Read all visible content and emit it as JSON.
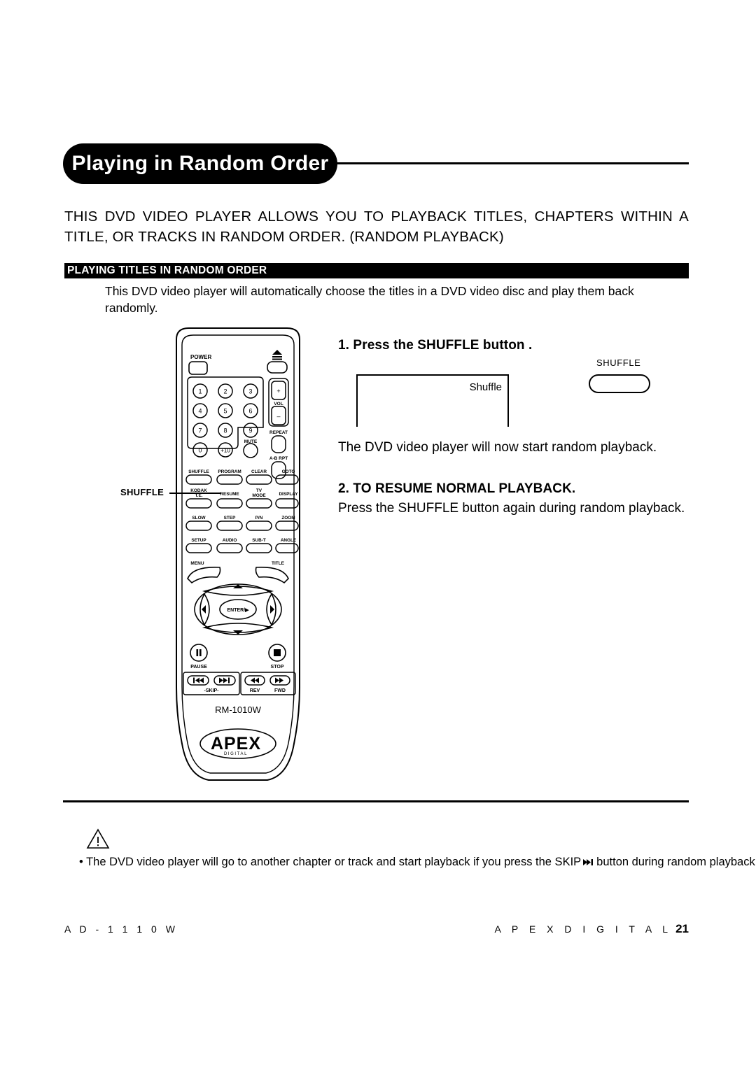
{
  "page": {
    "title": "Playing in Random Order",
    "intro": "THIS DVD VIDEO PLAYER ALLOWS YOU TO PLAYBACK TITLES, CHAPTERS WITHIN A TITLE, OR TRACKS IN RANDOM ORDER.  (RANDOM PLAYBACK)"
  },
  "section": {
    "bar_label": "PLAYING TITLES IN RANDOM ORDER",
    "description": "This DVD video player will automatically choose the titles in a DVD video disc and play them back randomly."
  },
  "steps": {
    "step1_heading": "1. Press the SHUFFLE button .",
    "osd_text": "Shuffle",
    "key_label": "SHUFFLE",
    "step1_result": "The DVD video player will now start random playback.",
    "step2_heading": "2. TO RESUME NORMAL PLAYBACK.",
    "step2_body": "Press the SHUFFLE button again during random playback."
  },
  "callout": {
    "label": "SHUFFLE"
  },
  "note": {
    "prefix": "• The DVD video player will go to another chapter or track and start playback if you press the SKIP",
    "suffix": "button during random playback.",
    "icon": "warning-triangle-icon",
    "skip_icon": "skip-forward-icon"
  },
  "footer": {
    "model": "A D - 1 1 1 0 W",
    "brand": "A P E X   D I G I T A L",
    "page_number": "21"
  },
  "remote": {
    "model_text": "RM-1010W",
    "logo_text": "APEX",
    "logo_sub": "DIGITAL",
    "power_label": "POWER",
    "eject_label": "eject-icon",
    "vol_label": "VOL",
    "vol_up": "+",
    "vol_down": "–",
    "repeat_label": "REPEAT",
    "ab_repeat_label": "A-B RPT",
    "mute_label": "MUTE",
    "numbers": [
      "1",
      "2",
      "3",
      "4",
      "5",
      "6",
      "7",
      "8",
      "9",
      "0",
      "+10"
    ],
    "function_rows": [
      [
        "SHUFFLE",
        "PROGRAM",
        "CLEAR",
        "GOTO"
      ],
      [
        "KODAK\nT.E.",
        "RESUME",
        "TV\nMODE",
        "DISPLAY"
      ],
      [
        "SLOW",
        "STEP",
        "P/N",
        "ZOOM"
      ],
      [
        "SETUP",
        "AUDIO",
        "SUB-T",
        "ANGLE"
      ]
    ],
    "menu_label": "MENU",
    "title_label": "TITLE",
    "enter_label": "ENTER/▶",
    "pause_label": "PAUSE",
    "stop_label": "STOP",
    "skip_label": "-SKIP-",
    "rev_label": "REV",
    "fwd_label": "FWD"
  },
  "colors": {
    "ink": "#000000",
    "paper": "#ffffff"
  }
}
